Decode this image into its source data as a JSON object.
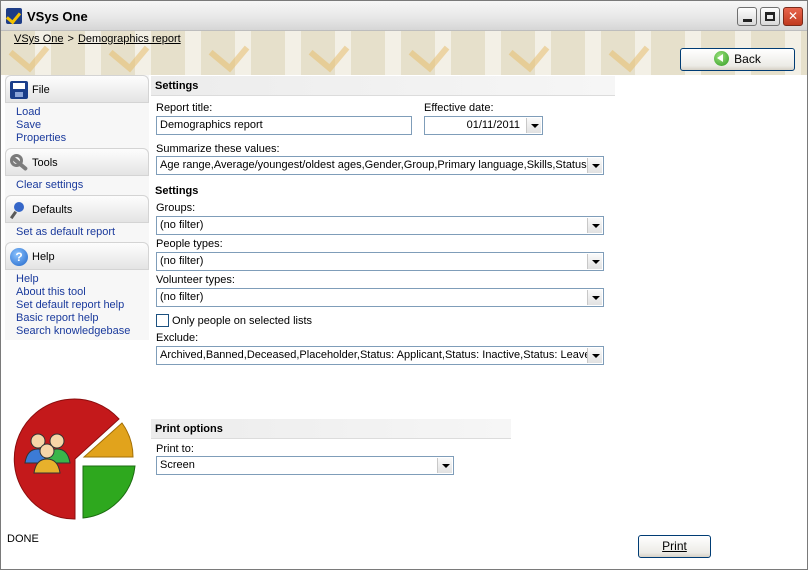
{
  "window": {
    "title": "VSys One"
  },
  "breadcrumb": {
    "root": "VSys One",
    "separator": ">",
    "current": "Demographics report"
  },
  "back_button": {
    "label": "Back"
  },
  "sidebar": {
    "file": {
      "title": "File",
      "links": [
        "Load",
        "Save",
        "Properties"
      ]
    },
    "tools": {
      "title": "Tools",
      "links": [
        "Clear settings"
      ]
    },
    "defaults": {
      "title": "Defaults",
      "links": [
        "Set as default report"
      ]
    },
    "help": {
      "title": "Help",
      "links": [
        "Help",
        "About this tool",
        "Set default report help",
        "Basic report help",
        "Search knowledgebase"
      ]
    }
  },
  "settings": {
    "heading": "Settings",
    "report_title_label": "Report title:",
    "report_title_value": "Demographics report",
    "effective_date_label": "Effective date:",
    "effective_date_value": "01/11/2011",
    "summarize_label": "Summarize these values:",
    "summarize_value": "Age range,Average/youngest/oldest ages,Gender,Group,Primary language,Skills,Status,"
  },
  "filters": {
    "heading": "Settings",
    "groups_label": "Groups:",
    "groups_value": "(no filter)",
    "people_types_label": "People types:",
    "people_types_value": "(no filter)",
    "volunteer_types_label": "Volunteer types:",
    "volunteer_types_value": "(no filter)",
    "only_selected_lists_label": "Only people on selected lists",
    "only_selected_lists_checked": false,
    "exclude_label": "Exclude:",
    "exclude_value": "Archived,Banned,Deceased,Placeholder,Status: Applicant,Status: Inactive,Status: Leave"
  },
  "print_options": {
    "heading": "Print options",
    "print_to_label": "Print to:",
    "print_to_value": "Screen",
    "print_button": "Print"
  },
  "status": {
    "text": "DONE"
  }
}
